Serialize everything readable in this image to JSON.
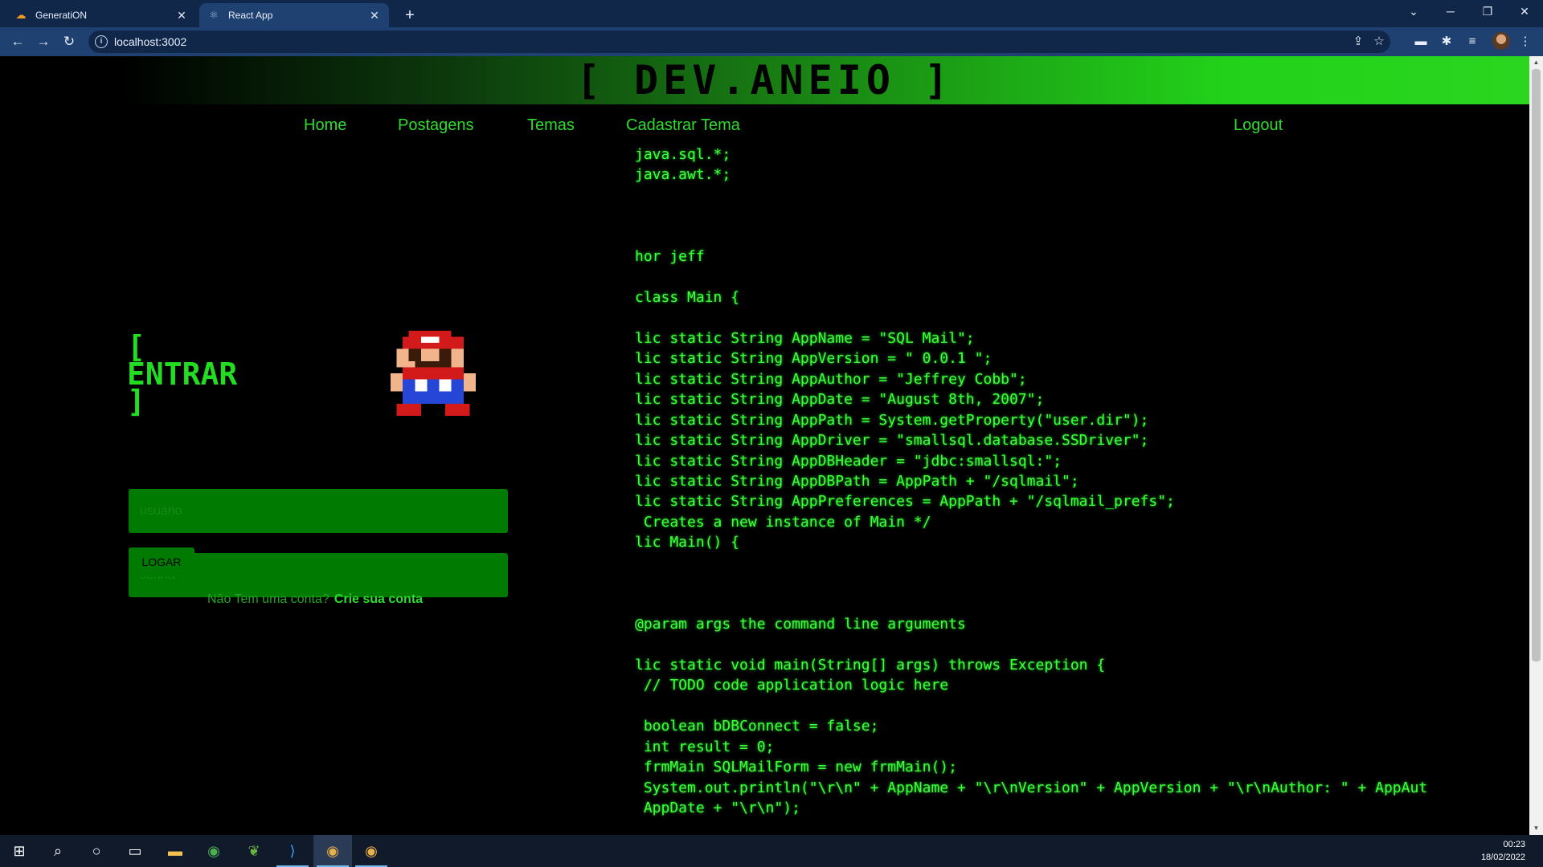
{
  "browser": {
    "tabs": [
      {
        "title": "GeneratiON",
        "icon": "cloud-orange-icon"
      },
      {
        "title": "React App",
        "icon": "react-icon"
      }
    ],
    "url": "localhost:3002"
  },
  "site": {
    "logo_text": "[ DEV.ANEIO ]",
    "nav": {
      "home": "Home",
      "posts": "Postagens",
      "themes": "Temas",
      "new_theme": "Cadastrar Tema",
      "logout": "Logout"
    },
    "colors": {
      "accent": "#2ddd2d",
      "input_bg": "#007a00",
      "background": "#000000"
    }
  },
  "login": {
    "title_line1": "[",
    "title_line2": "ENTRAR",
    "title_line3": "]",
    "username_placeholder": "usuário",
    "password_placeholder": "senha",
    "submit_label": "LOGAR",
    "signup_prompt": "Não Tem uma conta?",
    "signup_link": "Crie sua conta"
  },
  "background_code": [
    "java.sql.*;",
    "java.awt.*;",
    "",
    "",
    "",
    "hor jeff",
    "",
    "class Main {",
    "",
    "lic static String AppName = \"SQL Mail\";",
    "lic static String AppVersion = \" 0.0.1 \";",
    "lic static String AppAuthor = \"Jeffrey Cobb\";",
    "lic static String AppDate = \"August 8th, 2007\";",
    "lic static String AppPath = System.getProperty(\"user.dir\");",
    "lic static String AppDriver = \"smallsql.database.SSDriver\";",
    "lic static String AppDBHeader = \"jdbc:smallsql:\";",
    "lic static String AppDBPath = AppPath + \"/sqlmail\";",
    "lic static String AppPreferences = AppPath + \"/sqlmail_prefs\";",
    " Creates a new instance of Main */",
    "lic Main() {",
    "",
    "",
    "",
    "@param args the command line arguments",
    "",
    "lic static void main(String[] args) throws Exception {",
    " // TODO code application logic here",
    "",
    " boolean bDBConnect = false;",
    " int result = 0;",
    " frmMain SQLMailForm = new frmMain();",
    " System.out.println(\"\\r\\n\" + AppName + \"\\r\\nVersion\" + AppVersion + \"\\r\\nAuthor: \" + AppAut",
    " AppDate + \"\\r\\n\");"
  ],
  "taskbar": {
    "items": [
      "windows-start-icon",
      "search-icon",
      "cortana-icon",
      "task-view-icon",
      "file-explorer-icon",
      "chrome-icon",
      "spring-tools-icon",
      "vscode-icon",
      "chrome-profile-icon",
      "chrome-profile-2-icon"
    ],
    "time": "00:23",
    "date": "18/02/2022"
  }
}
